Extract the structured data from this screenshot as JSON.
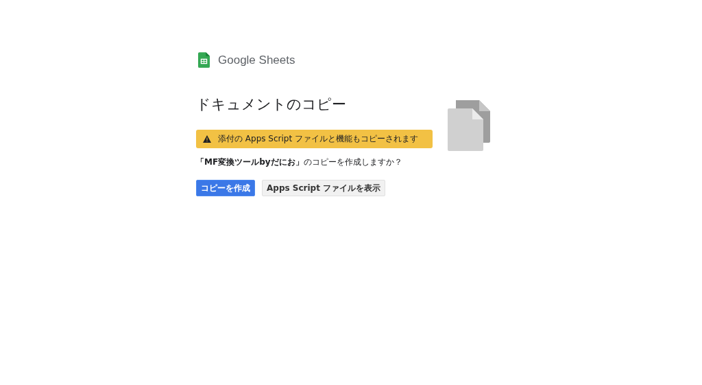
{
  "logo": {
    "product": "Google Sheets"
  },
  "title": "ドキュメントのコピー",
  "warning": "添付の Apps Script ファイルと機能もコピーされます",
  "question": "**「MF変換ツールbyだにお」**のコピーを作成しますか？",
  "buttons": [
    {
      "label": "コピーを作成",
      "kind": "primary"
    },
    {
      "label": "Apps Script ファイルを表示",
      "kind": "secondary"
    }
  ]
}
